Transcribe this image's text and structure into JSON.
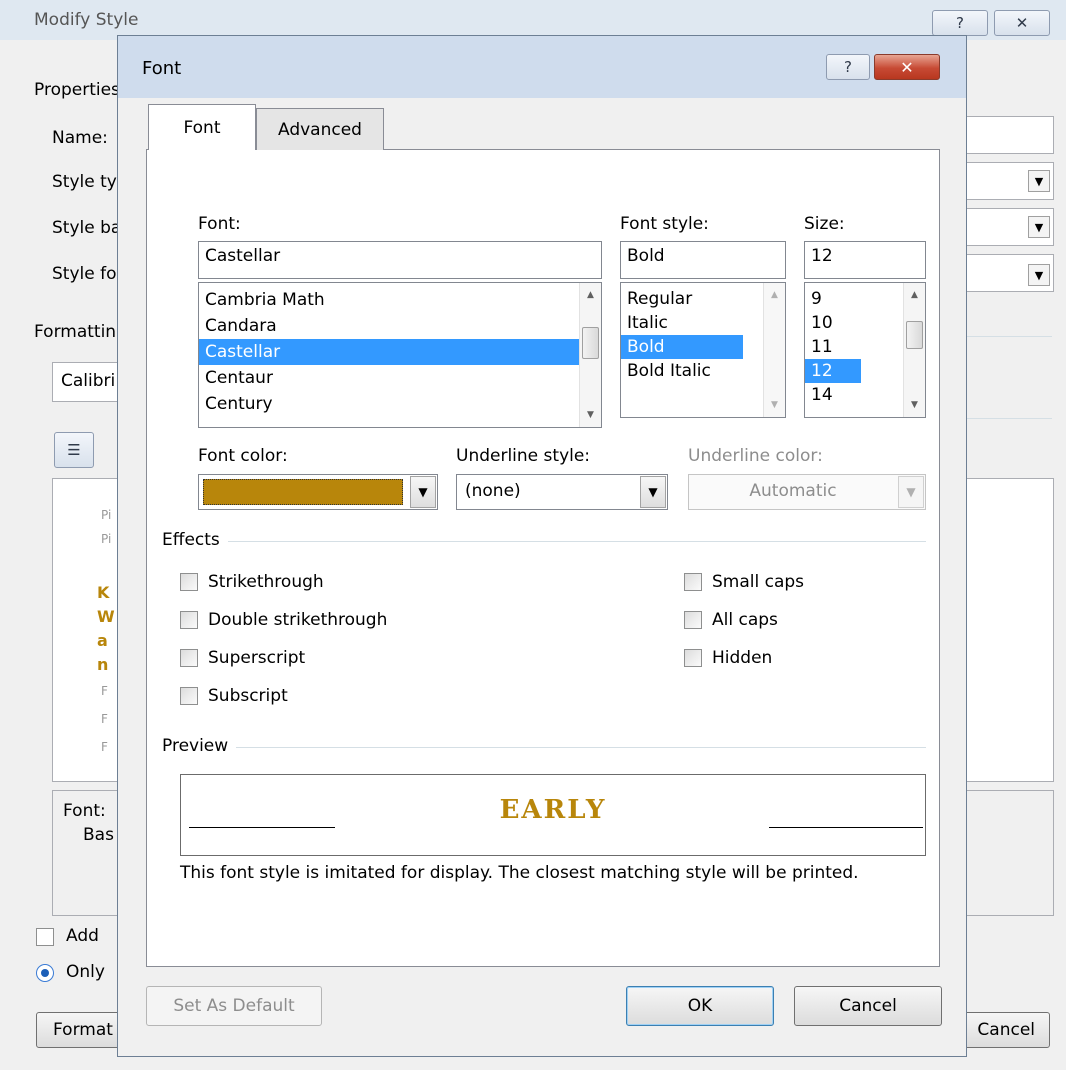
{
  "background_dialog": {
    "title": "Modify Style",
    "properties_label": "Properties",
    "name_label": "Name:",
    "style_type_label": "Style type:",
    "style_based_label": "Style based on:",
    "style_following_label": "Style for following paragraph:",
    "formatting_label": "Formatting",
    "font_value": "Calibri",
    "preview_prefix_lines": [
      "Pi",
      "Pi"
    ],
    "preview_bold_lines": [
      "K",
      "W",
      "a",
      "n"
    ],
    "preview_suffix_lines": [
      "F",
      "F",
      "F"
    ],
    "description_lines": [
      "Font:",
      "Bas"
    ],
    "add_label": "Add",
    "only_label": "Only",
    "format_button": "Format",
    "cancel_button": "Cancel"
  },
  "dialog": {
    "title": "Font",
    "tabs": [
      "Font",
      "Advanced"
    ],
    "font_label": "Font:",
    "font_value": "Castellar",
    "font_list": [
      "Cambria Math",
      "Candara",
      "Castellar",
      "Centaur",
      "Century"
    ],
    "font_selected_index": 2,
    "style_label": "Font style:",
    "style_value": "Bold",
    "style_list": [
      "Regular",
      "Italic",
      "Bold",
      "Bold Italic"
    ],
    "style_selected_index": 2,
    "size_label": "Size:",
    "size_value": "12",
    "size_list": [
      "9",
      "10",
      "11",
      "12",
      "14"
    ],
    "size_selected_index": 3,
    "font_color_label": "Font color:",
    "font_color": "#b8860b",
    "underline_style_label": "Underline style:",
    "underline_style_value": "(none)",
    "underline_color_label": "Underline color:",
    "underline_color_value": "Automatic",
    "effects_label": "Effects",
    "effects_left": [
      "Strikethrough",
      "Double strikethrough",
      "Superscript",
      "Subscript"
    ],
    "effects_right": [
      "Small caps",
      "All caps",
      "Hidden"
    ],
    "preview_label": "Preview",
    "preview_text": "EARLY",
    "preview_note": "This font style is imitated for display. The closest matching style will be printed.",
    "set_default_button": "Set As Default",
    "ok_button": "OK",
    "cancel_button": "Cancel"
  }
}
